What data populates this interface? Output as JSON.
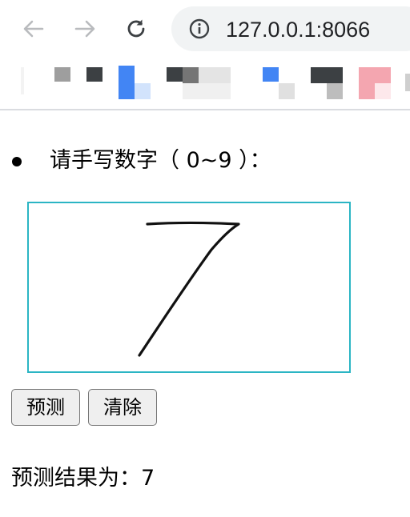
{
  "browser": {
    "url": "127.0.0.1:8066",
    "icons": {
      "back": "arrow-left-icon",
      "forward": "arrow-right-icon",
      "reload": "reload-icon",
      "site_info": "info-icon"
    }
  },
  "bookmarks": {
    "items_visible": 11,
    "note_colors": [
      "#9e9e9e",
      "#3c4043",
      "#4285f4",
      "#d2e3fc",
      "#e0e0e0",
      "#f4a6b0"
    ]
  },
  "page": {
    "prompt": "请手写数字（ 0~9 ）：",
    "canvas": {
      "border_color": "#2bb5c4",
      "drawn_digit": "7"
    },
    "buttons": {
      "predict_label": "预测",
      "clear_label": "清除"
    },
    "result": {
      "label": "预测结果为：",
      "value": "7"
    }
  }
}
